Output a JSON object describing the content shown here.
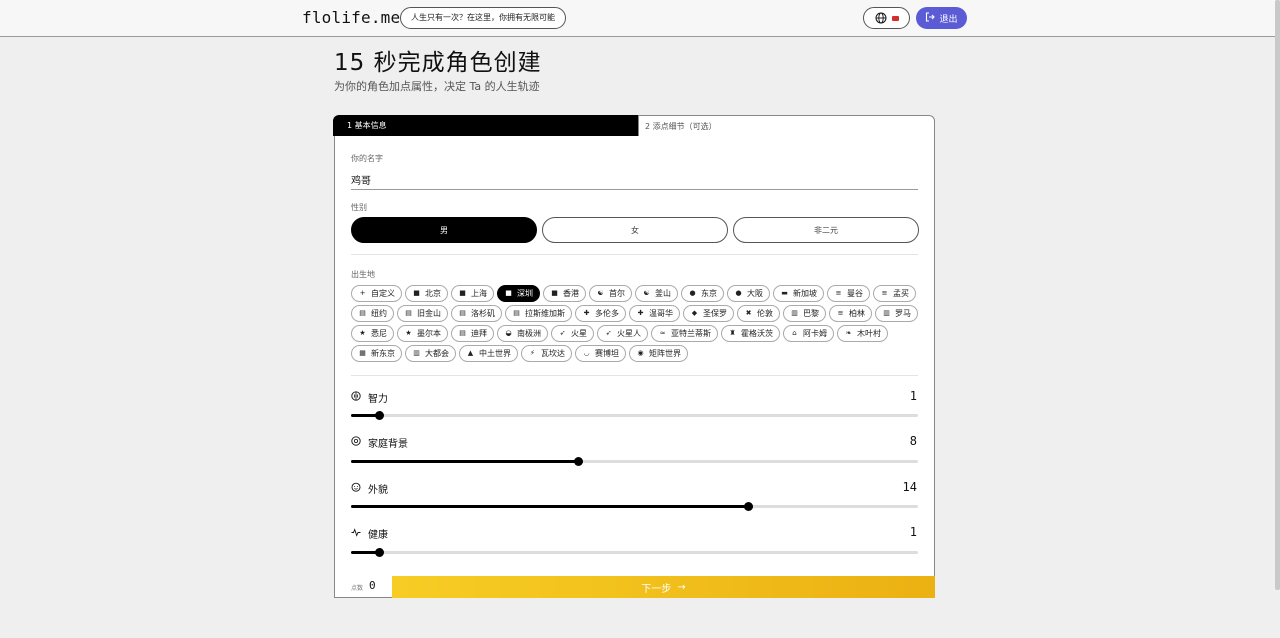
{
  "header": {
    "logo": "flolife.me",
    "tagline": "人生只有一次？在这里，你拥有无限可能",
    "logout_label": "退出"
  },
  "page": {
    "title": "15 秒完成角色创建",
    "subtitle": "为你的角色加点属性，决定 Ta 的人生轨迹"
  },
  "tabs": [
    {
      "label": "1 基本信息",
      "active": true
    },
    {
      "label": "2 添点细节（可选）",
      "active": false
    }
  ],
  "form": {
    "name_label": "你的名字",
    "name_value": "鸡哥",
    "gender_label": "性别",
    "gender_options": [
      "男",
      "女",
      "非二元"
    ],
    "gender_selected": "男",
    "birthplace_label": "出生地",
    "birthplaces": [
      {
        "icon": "+",
        "label": "自定义"
      },
      {
        "icon": "flag-cn",
        "label": "北京"
      },
      {
        "icon": "flag-cn",
        "label": "上海"
      },
      {
        "icon": "flag-cn",
        "label": "深圳"
      },
      {
        "icon": "flag-cn",
        "label": "香港"
      },
      {
        "icon": "flag-kr",
        "label": "首尔"
      },
      {
        "icon": "flag-kr",
        "label": "釜山"
      },
      {
        "icon": "flag-jp",
        "label": "东京"
      },
      {
        "icon": "flag-jp",
        "label": "大阪"
      },
      {
        "icon": "flag-sg",
        "label": "新加坡"
      },
      {
        "icon": "flag-th",
        "label": "曼谷"
      },
      {
        "icon": "flag-in",
        "label": "孟买"
      },
      {
        "icon": "flag-us",
        "label": "纽约"
      },
      {
        "icon": "flag-us",
        "label": "旧金山"
      },
      {
        "icon": "flag-us",
        "label": "洛杉矶"
      },
      {
        "icon": "flag-us",
        "label": "拉斯维加斯"
      },
      {
        "icon": "flag-ca",
        "label": "多伦多"
      },
      {
        "icon": "flag-ca",
        "label": "温哥华"
      },
      {
        "icon": "flag-br",
        "label": "圣保罗"
      },
      {
        "icon": "flag-gb",
        "label": "伦敦"
      },
      {
        "icon": "flag-fr",
        "label": "巴黎"
      },
      {
        "icon": "flag-de",
        "label": "柏林"
      },
      {
        "icon": "flag-it",
        "label": "罗马"
      },
      {
        "icon": "flag-au",
        "label": "悉尼"
      },
      {
        "icon": "flag-au",
        "label": "墨尔本"
      },
      {
        "icon": "flag-ae",
        "label": "迪拜"
      },
      {
        "icon": "penguin",
        "label": "南极洲"
      },
      {
        "icon": "rocket",
        "label": "火星"
      },
      {
        "icon": "rocket",
        "label": "火星人"
      },
      {
        "icon": "wave",
        "label": "亚特兰蒂斯"
      },
      {
        "icon": "castle",
        "label": "霍格沃茨"
      },
      {
        "icon": "temple",
        "label": "阿卡姆"
      },
      {
        "icon": "leaf",
        "label": "木叶村"
      },
      {
        "icon": "city",
        "label": "新东京"
      },
      {
        "icon": "building",
        "label": "大都会"
      },
      {
        "icon": "mountain",
        "label": "中土世界"
      },
      {
        "icon": "bolt",
        "label": "瓦坎达"
      },
      {
        "icon": "bowl",
        "label": "赛博坦"
      },
      {
        "icon": "pill",
        "label": "矩阵世界"
      }
    ],
    "birthplace_selected": "深圳"
  },
  "attributes": [
    {
      "label": "智力",
      "icon": "brain-icon",
      "value": "1",
      "fraction": 0.05
    },
    {
      "label": "家庭背景",
      "icon": "coin-icon",
      "value": "8",
      "fraction": 0.4
    },
    {
      "label": "外貌",
      "icon": "face-icon",
      "value": "14",
      "fraction": 0.7
    },
    {
      "label": "健康",
      "icon": "pulse-icon",
      "value": "1",
      "fraction": 0.05
    }
  ],
  "footer": {
    "points_label": "点数",
    "points_value": "0",
    "next_label": "下一步"
  },
  "colors": {
    "accent": "#5b5bd6",
    "next_button": "#f0bd17"
  }
}
